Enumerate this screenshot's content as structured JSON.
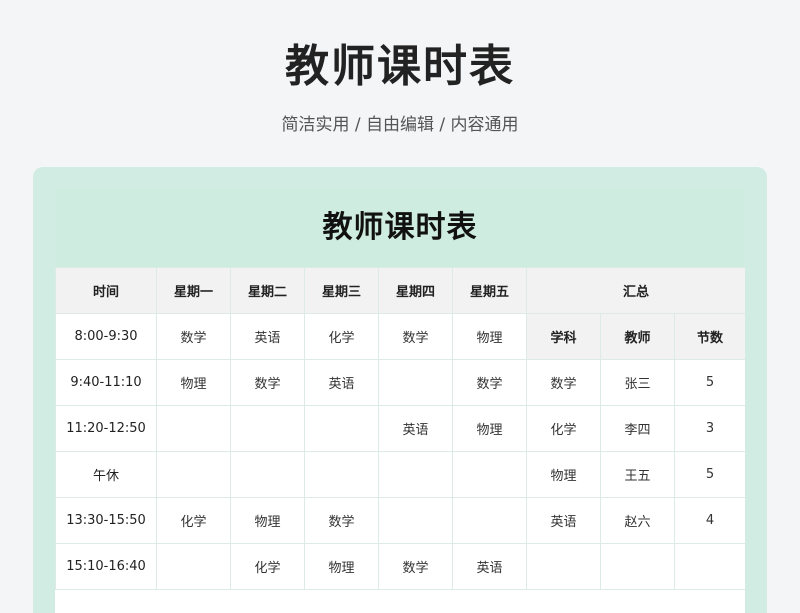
{
  "header": {
    "title": "教师课时表",
    "subtitle": "简洁实用 / 自由编辑 / 内容通用"
  },
  "sheet": {
    "title": "教师课时表",
    "columns": [
      "时间",
      "星期一",
      "星期二",
      "星期三",
      "星期四",
      "星期五"
    ],
    "summary_label": "汇总",
    "summary_columns": [
      "学科",
      "教师",
      "节数"
    ],
    "rows": [
      {
        "time": "8:00-9:30",
        "days": [
          "数学",
          "英语",
          "化学",
          "数学",
          "物理"
        ]
      },
      {
        "time": "9:40-11:10",
        "days": [
          "物理",
          "数学",
          "英语",
          "",
          "数学"
        ]
      },
      {
        "time": "11:20-12:50",
        "days": [
          "",
          "",
          "",
          "英语",
          "物理"
        ]
      },
      {
        "time": "午休",
        "days": [
          "",
          "",
          "",
          "",
          ""
        ]
      },
      {
        "time": "13:30-15:50",
        "days": [
          "化学",
          "物理",
          "数学",
          "",
          ""
        ]
      },
      {
        "time": "15:10-16:40",
        "days": [
          "",
          "化学",
          "物理",
          "数学",
          "英语"
        ]
      }
    ],
    "summary": [
      {
        "subject": "数学",
        "teacher": "张三",
        "count": "5"
      },
      {
        "subject": "化学",
        "teacher": "李四",
        "count": "3"
      },
      {
        "subject": "物理",
        "teacher": "王五",
        "count": "5"
      },
      {
        "subject": "英语",
        "teacher": "赵六",
        "count": "4"
      },
      {
        "subject": "",
        "teacher": "",
        "count": ""
      }
    ]
  },
  "colors": {
    "page_background": "#f4f5f7",
    "accent": "#cfece1",
    "header_fill": "#f2f2f2",
    "grid_line": "#dcebe6"
  }
}
